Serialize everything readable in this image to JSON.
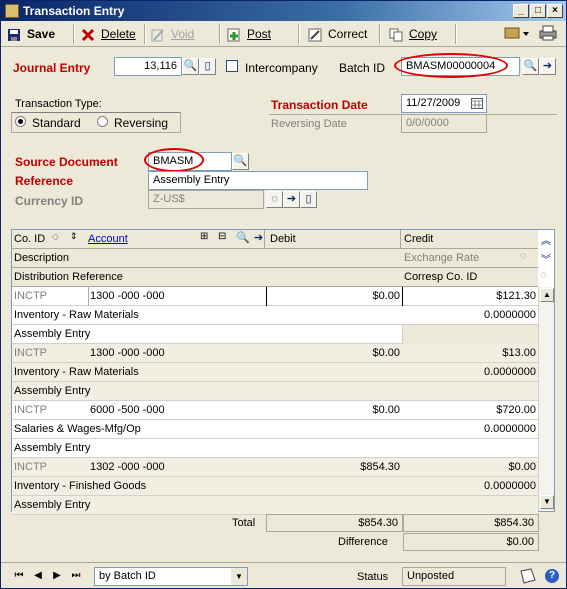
{
  "window": {
    "title": "Transaction Entry"
  },
  "toolbar": {
    "save": "Save",
    "delete": "Delete",
    "void": "Void",
    "post": "Post",
    "correct": "Correct",
    "copy": "Copy"
  },
  "header": {
    "journal_entry_label": "Journal Entry",
    "journal_entry_value": "13,116",
    "intercompany_label": "Intercompany",
    "batch_id_label": "Batch ID",
    "batch_id_value": "BMASM00000004",
    "transaction_type_label": "Transaction Type:",
    "type_standard": "Standard",
    "type_reversing": "Reversing",
    "transaction_date_label": "Transaction Date",
    "transaction_date_value": "11/27/2009",
    "reversing_date_label": "Reversing Date",
    "reversing_date_value": "0/0/0000",
    "source_document_label": "Source Document",
    "source_document_value": "BMASM",
    "reference_label": "Reference",
    "reference_value": "Assembly Entry",
    "currency_id_label": "Currency ID",
    "currency_id_value": "Z-US$"
  },
  "grid": {
    "col_co_id": "Co. ID",
    "col_account": "Account",
    "col_debit": "Debit",
    "col_credit": "Credit",
    "col_description": "Description",
    "col_exchange_rate": "Exchange Rate",
    "col_distribution_reference": "Distribution Reference",
    "col_corresp_co_id": "Corresp Co. ID",
    "entries": [
      {
        "co_id": "INCTP",
        "account": "1300 -000 -000",
        "debit": "$0.00",
        "credit": "$121.30",
        "description": "Inventory - Raw Materials",
        "exchange_rate": "0.0000000",
        "dist_ref": "Assembly Entry"
      },
      {
        "co_id": "INCTP",
        "account": "1300 -000 -000",
        "debit": "$0.00",
        "credit": "$13.00",
        "description": "Inventory - Raw Materials",
        "exchange_rate": "0.0000000",
        "dist_ref": "Assembly Entry"
      },
      {
        "co_id": "INCTP",
        "account": "6000 -500 -000",
        "debit": "$0.00",
        "credit": "$720.00",
        "description": "Salaries & Wages-Mfg/Op",
        "exchange_rate": "0.0000000",
        "dist_ref": "Assembly Entry"
      },
      {
        "co_id": "INCTP",
        "account": "1302 -000 -000",
        "debit": "$854.30",
        "credit": "$0.00",
        "description": "Inventory - Finished Goods",
        "exchange_rate": "0.0000000",
        "dist_ref": "Assembly Entry"
      }
    ]
  },
  "totals": {
    "total_label": "Total",
    "total_debit": "$854.30",
    "total_credit": "$854.30",
    "difference_label": "Difference",
    "difference_value": "$0.00"
  },
  "status": {
    "sort_value": "by Batch ID",
    "status_label": "Status",
    "status_value": "Unposted"
  }
}
